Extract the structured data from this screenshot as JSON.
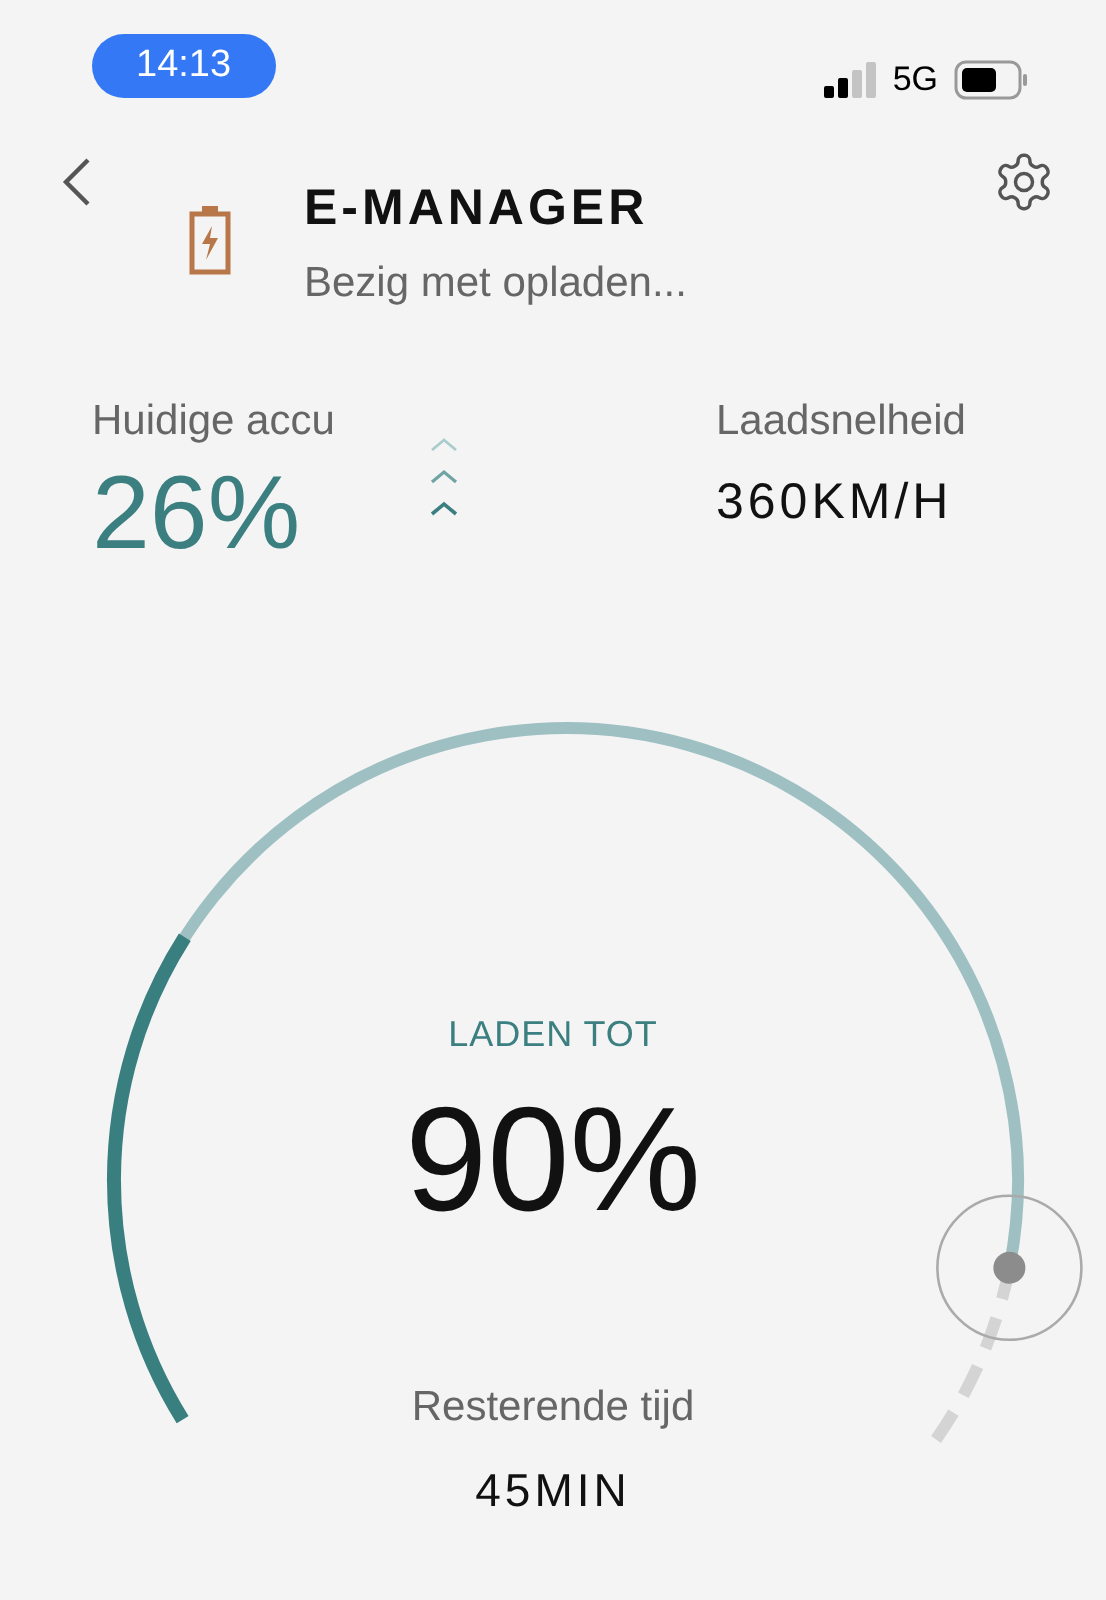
{
  "status_bar": {
    "time": "14:13",
    "network": "5G"
  },
  "header": {
    "title": "E-MANAGER",
    "subtitle": "Bezig met opladen..."
  },
  "current_battery": {
    "label": "Huidige accu",
    "value": "26%"
  },
  "charge_speed": {
    "label": "Laadsnelheid",
    "value": "360KM/H"
  },
  "gauge": {
    "target": {
      "label": "LADEN TOT",
      "value": "90%"
    },
    "remaining": {
      "label": "Resterende tijd",
      "value": "45MIN"
    }
  }
}
